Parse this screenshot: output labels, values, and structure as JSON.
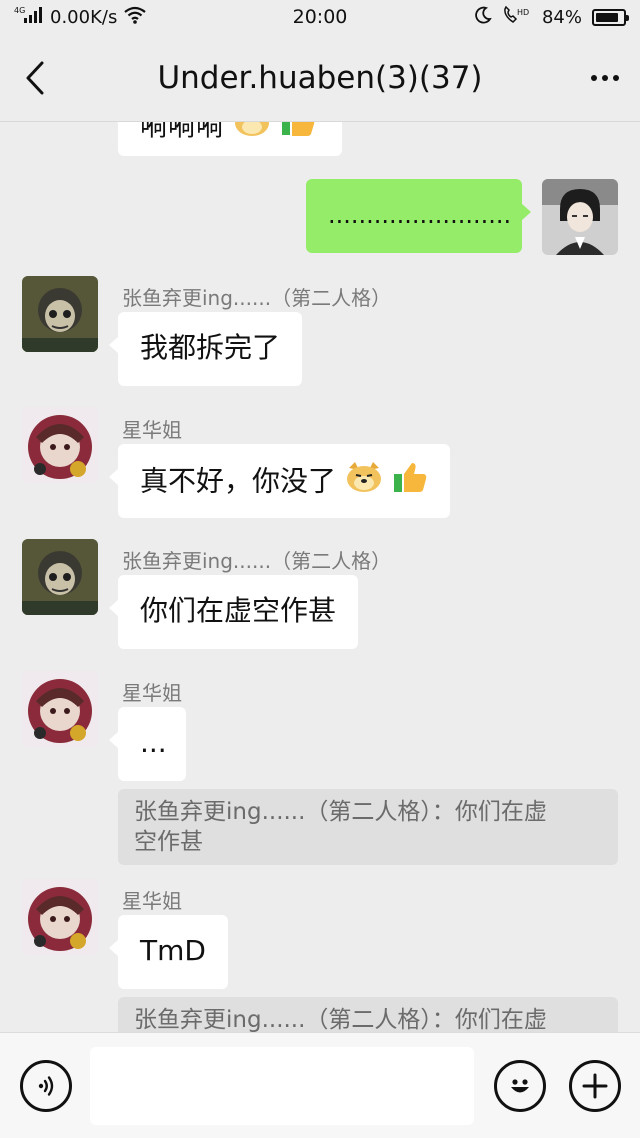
{
  "status_bar": {
    "network": "4G",
    "speed": "0.00K/s",
    "time": "20:00",
    "battery": "84%",
    "battery_level": 0.84
  },
  "header": {
    "title": "Under.huaben(3)(37)"
  },
  "messages": {
    "partial_top": {
      "text": "嗬嗬嗬"
    },
    "m_self": {
      "text": "........................"
    },
    "m2": {
      "sender": "张鱼弃更ing......（第二人格）",
      "text": "我都拆完了"
    },
    "m3": {
      "sender": "星华姐",
      "text": "真不好，你没了"
    },
    "m4": {
      "sender": "张鱼弃更ing......（第二人格）",
      "text": "你们在虚空作甚"
    },
    "m5": {
      "sender": "星华姐",
      "text": "...",
      "quote_line1": "张鱼弃更ing......（第二人格）：你们在虚",
      "quote_line2": "空作甚"
    },
    "m6": {
      "sender": "星华姐",
      "text": "TmD",
      "quote_line1": "张鱼弃更ing......（第二人格）：你们在虚"
    }
  },
  "colors": {
    "background": "#ededed",
    "self_bubble": "#95ec69",
    "other_bubble": "#ffffff"
  },
  "icons": {
    "voice": "voice-icon",
    "emoji": "emoji-icon",
    "add": "plus-icon",
    "back": "back-arrow-icon",
    "more": "more-icon"
  }
}
